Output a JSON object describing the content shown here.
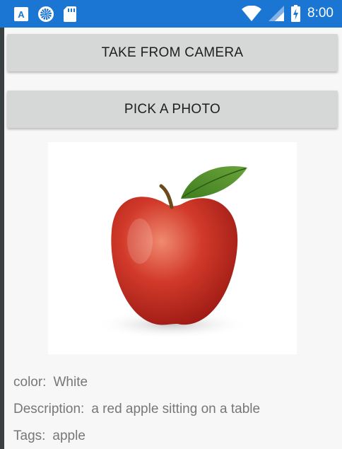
{
  "status_bar": {
    "time": "8:00",
    "left_icons": [
      "a-box-icon",
      "loading-circle-icon",
      "sd-card-icon"
    ],
    "right_icons": [
      "wifi-icon",
      "signal-icon",
      "battery-icon"
    ],
    "a_icon_letter": "A",
    "color": "#1a76d2"
  },
  "buttons": {
    "camera_label": "TAKE FROM CAMERA",
    "pick_label": "PICK A PHOTO"
  },
  "photo": {
    "subject": "apple-image"
  },
  "result": {
    "color_label": "color:",
    "color_value": "White",
    "description_label": "Description:",
    "description_value": "a red apple sitting on a table",
    "tags_label": "Tags:",
    "tags_value": "apple"
  }
}
